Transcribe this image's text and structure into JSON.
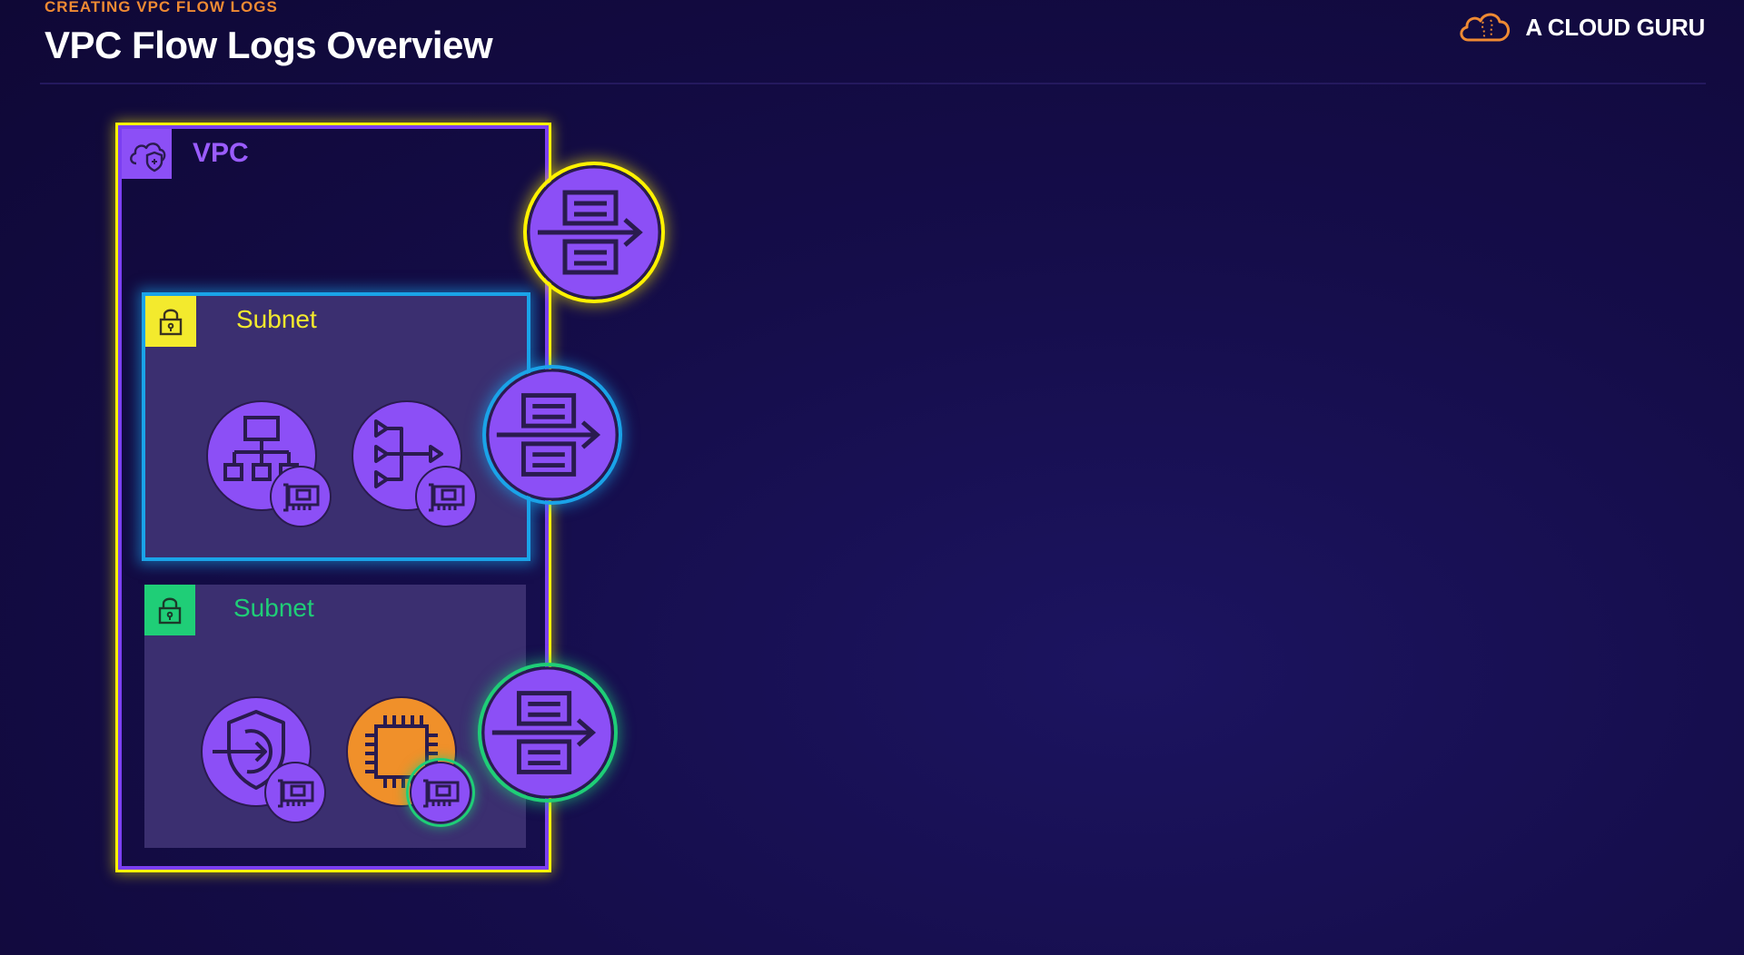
{
  "header": {
    "subtitle": "CREATING VPC FLOW LOGS",
    "title": "VPC Flow Logs Overview",
    "brand": "A CLOUD GURU",
    "brand_icon": "cloud-logo-icon"
  },
  "diagram": {
    "vpc": {
      "label": "VPC",
      "icon": "vpc-cloud-shield-icon",
      "flow_log_icon": "flow-logs-icon"
    },
    "subnets": [
      {
        "label": "Subnet",
        "icon": "lock-icon",
        "flow_log_icon": "flow-logs-icon",
        "services": [
          {
            "icon": "load-balancer-hierarchy-icon",
            "badge": "network-interface-icon"
          },
          {
            "icon": "nat-gateway-routing-icon",
            "badge": "network-interface-icon"
          }
        ]
      },
      {
        "label": "Subnet",
        "icon": "lock-icon",
        "flow_log_icon": "flow-logs-icon",
        "services": [
          {
            "icon": "vpc-endpoint-shield-icon",
            "badge": "network-interface-icon"
          },
          {
            "icon": "ec2-chip-icon",
            "badge": "network-interface-icon"
          }
        ]
      }
    ]
  },
  "colors": {
    "background": "#130b40",
    "accent_orange": "#ef8a33",
    "vpc_purple": "#8c4ff6",
    "vpc_highlight": "#fff200",
    "subnet_a_highlight": "#1aa3e8",
    "subnet_a_lock": "#f3ea2d",
    "subnet_b_lock": "#1fce77",
    "subnet_b_highlight": "#1fce77",
    "ec2_orange": "#f0902a"
  }
}
